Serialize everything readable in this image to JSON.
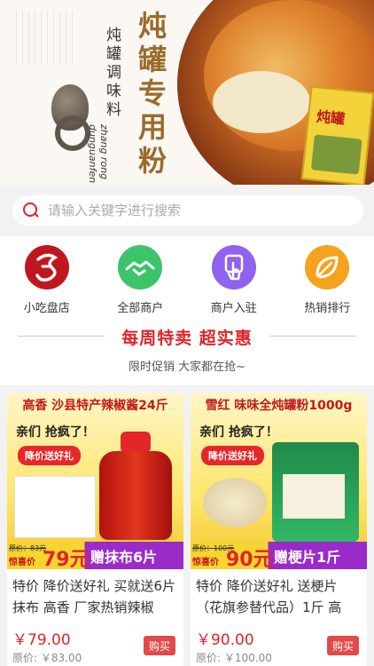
{
  "banner": {
    "main_title": "炖罐专用粉",
    "sub_title": "炖罐调味料",
    "pinyin": "zhang rong dunguanfen",
    "package_title": "炖罐"
  },
  "search": {
    "placeholder": "请输入关键字进行搜索",
    "icon": "search-icon"
  },
  "categories": [
    {
      "label": "小吃盘店",
      "icon": "shop-logo-icon",
      "color": "#c0171e"
    },
    {
      "label": "全部商户",
      "icon": "handshake-icon",
      "color": "#3cc46a"
    },
    {
      "label": "商户入驻",
      "icon": "touch-icon",
      "color": "#8f62f0"
    },
    {
      "label": "热销排行",
      "icon": "leaf-icon",
      "color": "#f5a21f"
    }
  ],
  "promo": {
    "title": "每周特卖 超实惠",
    "subtitle": "限时促销 大家都在抢~"
  },
  "products": [
    {
      "image": {
        "title": "高香 沙县特产辣椒酱24斤",
        "slogan": "亲们 抢疯了！",
        "badge": "降价送好礼",
        "orig": "原价：83元",
        "tag": "惊喜价",
        "big_price": "79元",
        "gift": "赠抹布6片"
      },
      "description": "特价 降价送好礼 买就送6片抹布 高香 厂家热销辣椒",
      "price": "￥79.00",
      "original_price": "原价: ￥83.00",
      "buy_label": "购买"
    },
    {
      "image": {
        "title": "雪红 味味全炖罐粉1000g",
        "slogan": "亲们 抢疯了！",
        "badge": "降价送好礼",
        "orig": "原价：100元",
        "tag": "惊喜价",
        "big_price": "90元",
        "gift": "赠梗片1斤"
      },
      "description": "特价 降价送好礼 送梗片（花旗参替代品）1斤 高",
      "price": "￥90.00",
      "original_price": "原价: ￥100.00",
      "buy_label": "购买"
    }
  ]
}
